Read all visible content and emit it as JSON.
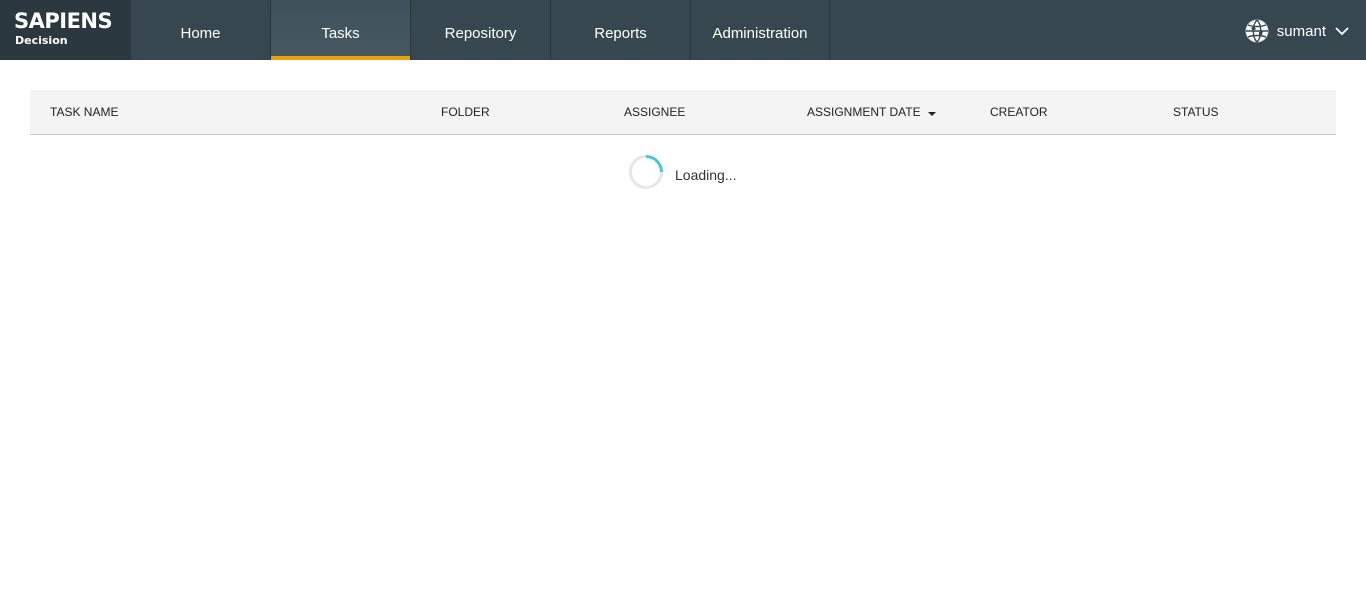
{
  "brand": {
    "name": "SAPIENS",
    "product": "Decision"
  },
  "nav": {
    "tabs": [
      {
        "label": "Home",
        "active": false
      },
      {
        "label": "Tasks",
        "active": true
      },
      {
        "label": "Repository",
        "active": false
      },
      {
        "label": "Reports",
        "active": false
      },
      {
        "label": "Administration",
        "active": false
      }
    ]
  },
  "user": {
    "name": "sumant",
    "avatar_icon": "globe-icon",
    "menu_icon": "chevron-down-icon"
  },
  "table": {
    "columns": [
      {
        "label": "TASK NAME"
      },
      {
        "label": "FOLDER"
      },
      {
        "label": "ASSIGNEE"
      },
      {
        "label": "ASSIGNMENT DATE",
        "sort": "descending"
      },
      {
        "label": "CREATOR"
      },
      {
        "label": "STATUS"
      }
    ]
  },
  "status": {
    "loading_text": "Loading..."
  },
  "colors": {
    "topbar": "#37474f",
    "active_tab_underline": "#e8a30c",
    "spinner": "#4fc3e0"
  }
}
